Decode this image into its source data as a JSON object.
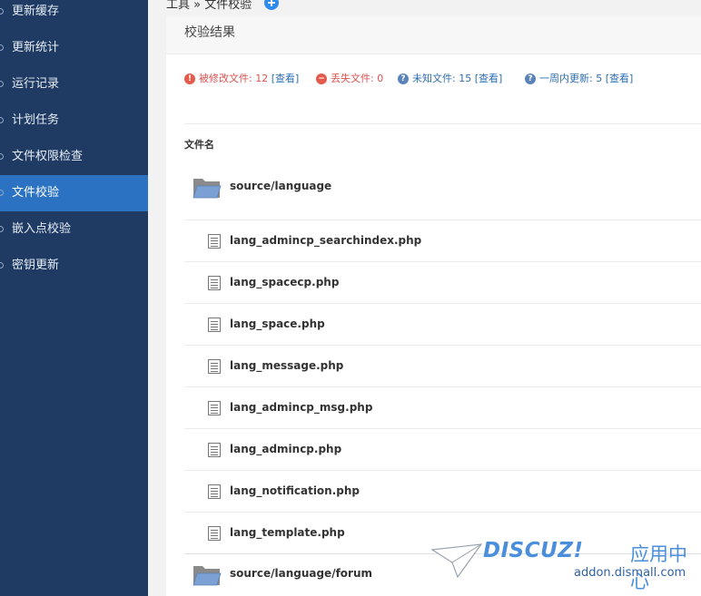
{
  "sidebar": {
    "items": [
      {
        "label": "更新缓存",
        "active": false
      },
      {
        "label": "更新统计",
        "active": false
      },
      {
        "label": "运行记录",
        "active": false
      },
      {
        "label": "计划任务",
        "active": false
      },
      {
        "label": "文件权限检查",
        "active": false
      },
      {
        "label": "文件校验",
        "active": true
      },
      {
        "label": "嵌入点校验",
        "active": false
      },
      {
        "label": "密钥更新",
        "active": false
      }
    ]
  },
  "breadcrumb": {
    "text": "工具 » 文件校验"
  },
  "panel": {
    "title": "校验结果",
    "stats": [
      {
        "label": "被修改文件: 12",
        "link": "[查看]",
        "color": "#d9534f",
        "icon": "error-icon"
      },
      {
        "label": "丢失文件: 0",
        "link": "",
        "color": "#d9534f",
        "icon": "minus-icon"
      },
      {
        "label": "未知文件: 15",
        "link": "[查看]",
        "color": "#2e6fb0",
        "icon": "question-icon"
      },
      {
        "label": "一周内更新: 5",
        "link": "[查看]",
        "color": "#2e6fb0",
        "icon": "question-icon"
      }
    ],
    "column_header": "文件名",
    "folders": [
      {
        "path": "source/language"
      },
      {
        "path": "source/language/forum"
      }
    ],
    "files": [
      "lang_admincp_searchindex.php",
      "lang_spacecp.php",
      "lang_space.php",
      "lang_message.php",
      "lang_admincp_msg.php",
      "lang_admincp.php",
      "lang_notification.php",
      "lang_template.php"
    ]
  },
  "watermark": {
    "brand": "DISCUZ!",
    "cn": "应用中心",
    "url": "addon.dismall.com"
  }
}
